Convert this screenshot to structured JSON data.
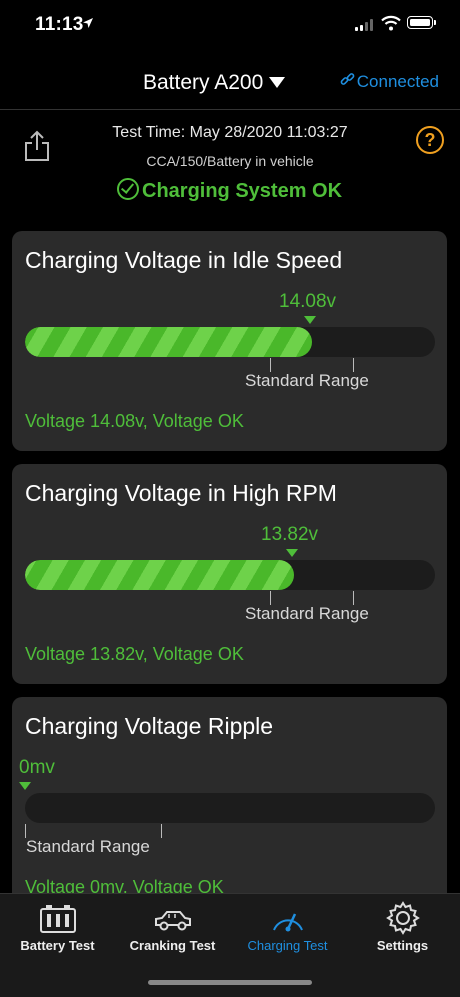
{
  "status_bar": {
    "time": "11:13"
  },
  "nav": {
    "title": "Battery A200",
    "connection": "Connected"
  },
  "header": {
    "test_time": "Test Time:  May 28/2020 11:03:27",
    "test_info": "CCA/150/Battery in vehicle",
    "overall_status": "Charging System OK"
  },
  "cards": [
    {
      "title": "Charging Voltage in Idle Speed",
      "reading": "14.08v",
      "fill_fraction": 0.7,
      "range_label": "Standard Range",
      "result": "Voltage 14.08v, Voltage OK"
    },
    {
      "title": "Charging Voltage in High RPM",
      "reading": "13.82v",
      "fill_fraction": 0.655,
      "range_label": "Standard Range",
      "result": "Voltage 13.82v, Voltage OK"
    },
    {
      "title": "Charging Voltage Ripple",
      "reading": "0mv",
      "fill_fraction": 0,
      "range_label": "Standard Range",
      "result": "Voltage 0mv, Voltage OK"
    }
  ],
  "tabs": [
    {
      "label": "Battery Test",
      "icon": "battery-test-icon",
      "active": false
    },
    {
      "label": "Cranking Test",
      "icon": "car-icon",
      "active": false
    },
    {
      "label": "Charging Test",
      "icon": "gauge-icon",
      "active": true
    },
    {
      "label": "Settings",
      "icon": "gear-icon",
      "active": false
    }
  ],
  "colors": {
    "accent_green": "#4fbe3a",
    "link_blue": "#1f8fe0",
    "help_orange": "#f0a020"
  }
}
